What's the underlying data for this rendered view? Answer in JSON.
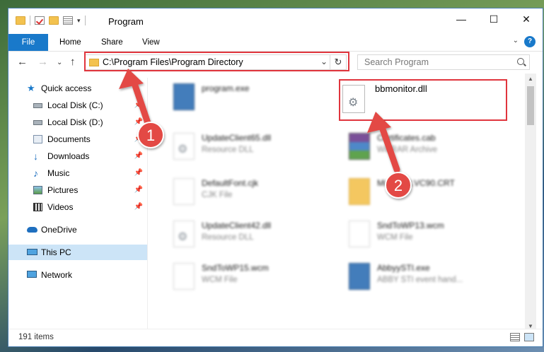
{
  "window": {
    "title": "Program",
    "controls": {
      "minimize": "—",
      "maximize": "☐",
      "close": "✕"
    }
  },
  "ribbon": {
    "tabs": [
      {
        "label": "File"
      },
      {
        "label": "Home"
      },
      {
        "label": "Share"
      },
      {
        "label": "View"
      }
    ],
    "help_label": "?"
  },
  "nav": {
    "back_icon": "arrow-left-icon",
    "forward_icon": "arrow-right-icon",
    "address": "C:\\Program Files\\Program Directory",
    "search_placeholder": "Search Program"
  },
  "sidebar": {
    "items": [
      {
        "label": "Quick access",
        "icon": "star-icon",
        "pinned": false
      },
      {
        "label": "Local Disk (C:)",
        "icon": "drive-icon",
        "pinned": true
      },
      {
        "label": "Local Disk (D:)",
        "icon": "drive-icon",
        "pinned": true
      },
      {
        "label": "Documents",
        "icon": "documents-icon",
        "pinned": true
      },
      {
        "label": "Downloads",
        "icon": "downloads-icon",
        "pinned": true
      },
      {
        "label": "Music",
        "icon": "music-icon",
        "pinned": true
      },
      {
        "label": "Pictures",
        "icon": "pictures-icon",
        "pinned": true
      },
      {
        "label": "Videos",
        "icon": "videos-icon",
        "pinned": true
      },
      {
        "label": "OneDrive",
        "icon": "cloud-icon",
        "pinned": false
      },
      {
        "label": "This PC",
        "icon": "computer-icon",
        "pinned": false,
        "selected": true
      },
      {
        "label": "Network",
        "icon": "network-icon",
        "pinned": false
      }
    ]
  },
  "files": [
    {
      "name": "program.exe",
      "type": "",
      "icon": "app-icon"
    },
    {
      "name": "UpdateClient65.dll",
      "type": "Resource DLL",
      "icon": "gear-file-icon"
    },
    {
      "name": "Certificates.cab",
      "type": "WinRAR Archive",
      "icon": "rar-icon"
    },
    {
      "name": "DefaultFont.cjk",
      "type": "CJK File",
      "icon": "file-icon"
    },
    {
      "name": "Microsoft.VC90.CRT",
      "type": "",
      "icon": "zip-folder-icon"
    },
    {
      "name": "UpdateClient42.dll",
      "type": "Resource DLL",
      "icon": "gear-file-icon"
    },
    {
      "name": "SndToWP13.wcm",
      "type": "WCM File",
      "icon": "file-icon"
    },
    {
      "name": "SndToWP15.wcm",
      "type": "WCM File",
      "icon": "file-icon"
    },
    {
      "name": "AbbyySTI.exe",
      "type": "ABBY STI event hand...",
      "icon": "app-icon"
    }
  ],
  "highlighted_file": {
    "name": "bbmonitor.dll",
    "icon": "gear-file-icon"
  },
  "annotations": [
    {
      "number": "1",
      "target": "address bar"
    },
    {
      "number": "2",
      "target": "bbmonitor.dll"
    }
  ],
  "status": {
    "item_count": "191 items"
  },
  "colors": {
    "accent": "#1979ca",
    "highlight": "#e0353d",
    "selected_bg": "#cce4f7"
  }
}
